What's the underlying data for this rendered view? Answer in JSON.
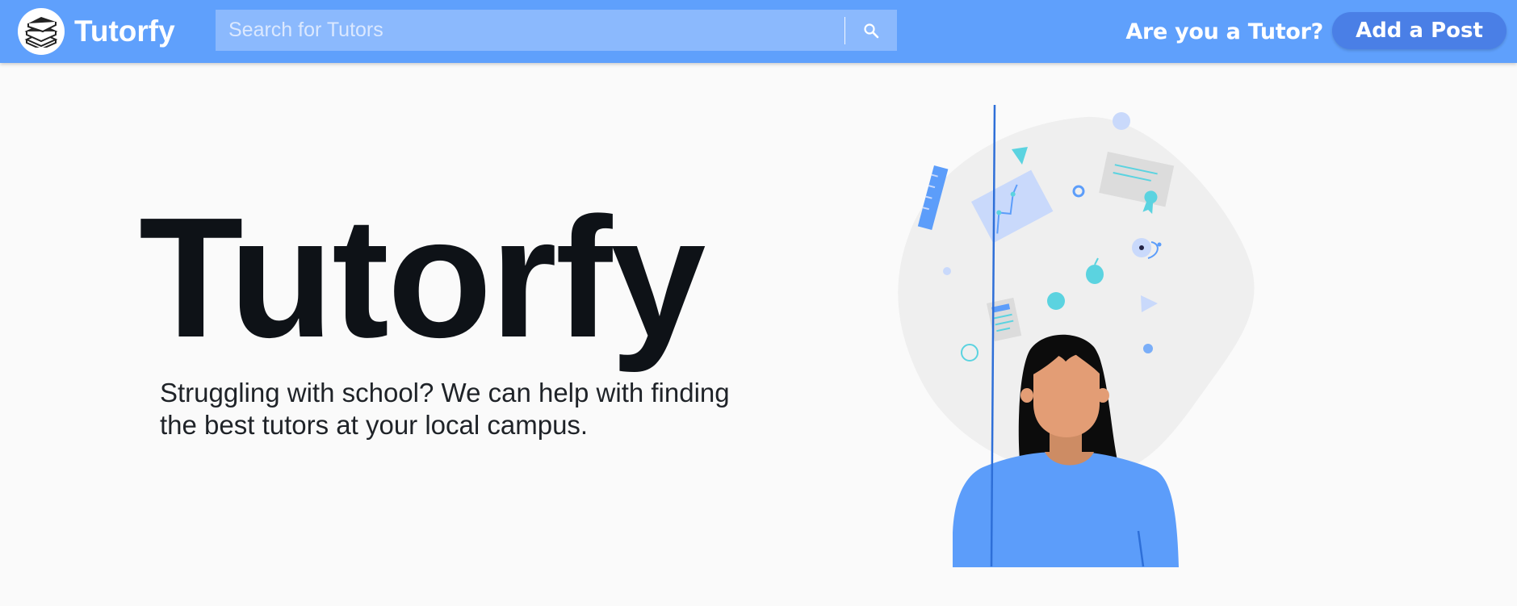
{
  "navbar": {
    "brand": "Tutorfy",
    "search_placeholder": "Search for Tutors",
    "tutor_question": "Are you a Tutor?",
    "add_post_label": "Add a Post"
  },
  "hero": {
    "title": "Tutorfy",
    "subtitle": "Struggling with school? We can help with finding the best tutors at your local campus."
  },
  "icons": {
    "logo": "books-stack-icon",
    "search": "search-icon"
  },
  "colors": {
    "navbar": "#5fa0fc",
    "search_bg": "#8bb9fd",
    "button": "#4a7fe6",
    "accent_teal": "#5bd3e0",
    "shirt": "#5c9dfa"
  }
}
